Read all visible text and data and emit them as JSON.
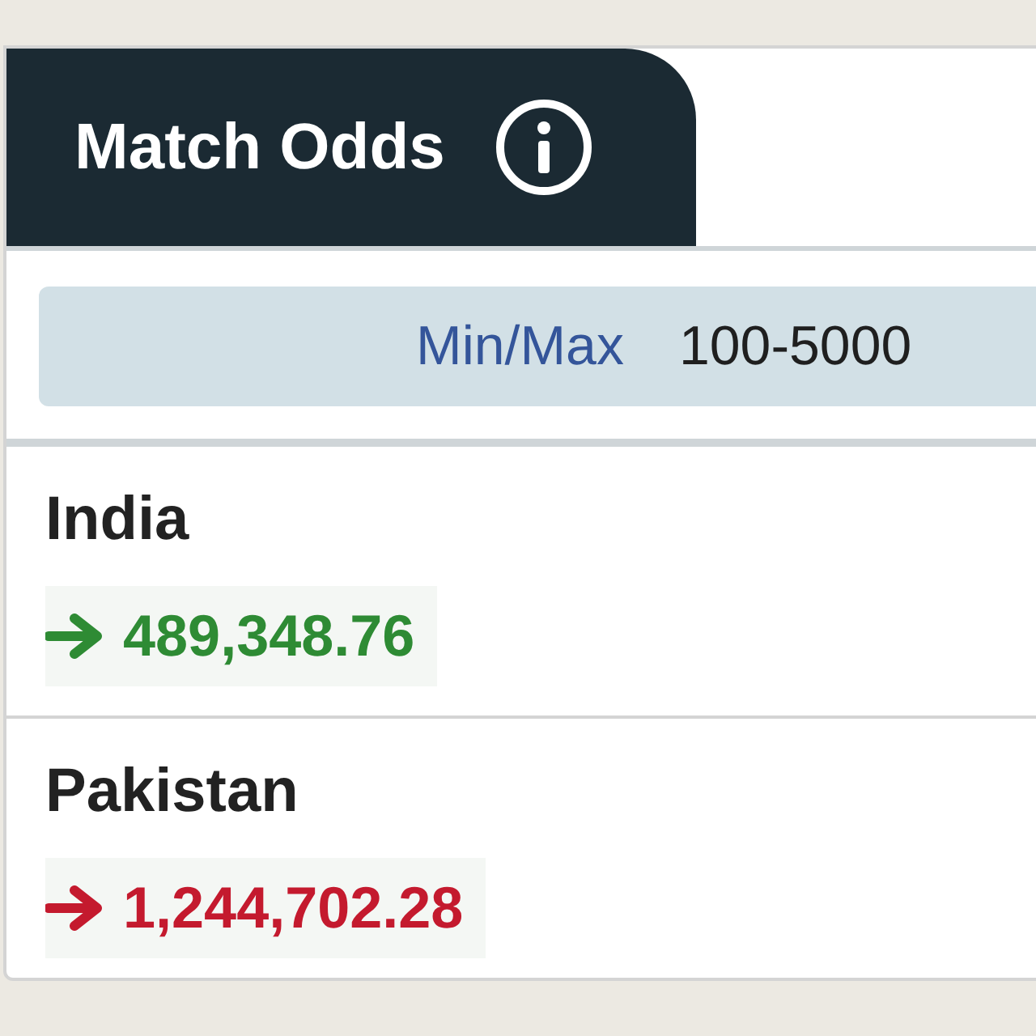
{
  "market": {
    "title": "Match Odds",
    "min_max_label": "Min/Max",
    "min_max_value": "100-5000"
  },
  "runners": [
    {
      "name": "India",
      "color": "#2e8b34",
      "amount": "489,348.76"
    },
    {
      "name": "Pakistan",
      "color": "#c41a2e",
      "amount": "1,244,702.28"
    }
  ]
}
